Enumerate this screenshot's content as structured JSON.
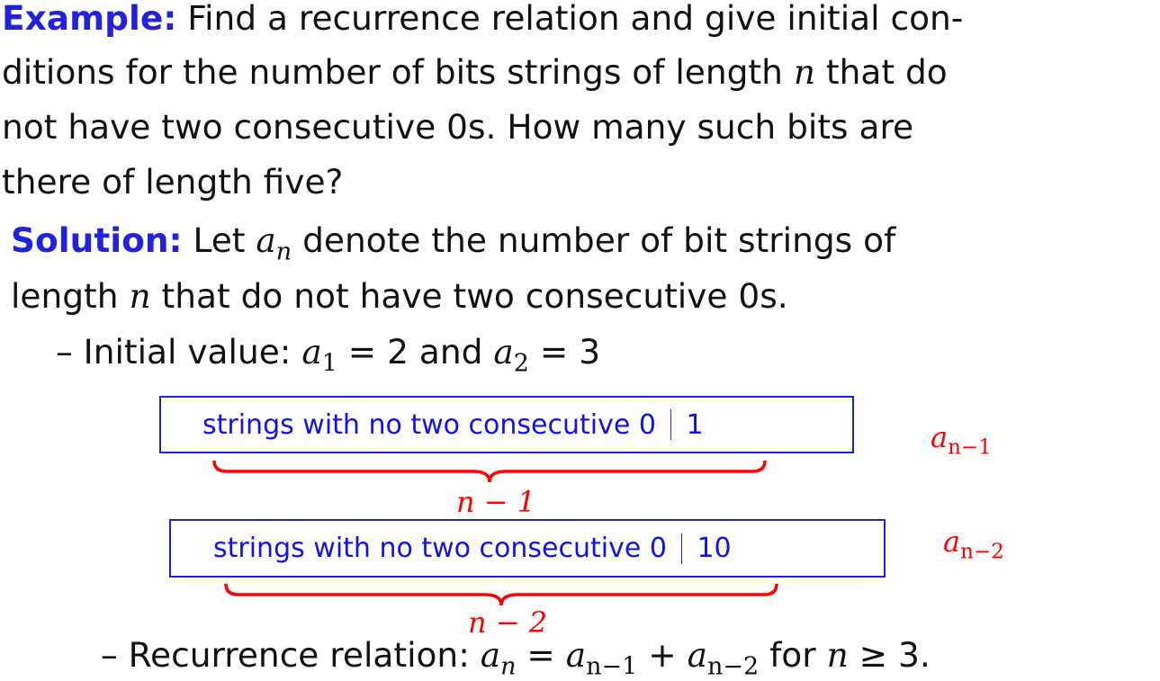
{
  "example": {
    "label": "Example:",
    "t1": " Find a recurrence relation and give initial con-",
    "t2a": "ditions for the number of bits strings of length ",
    "var_n": "n",
    "t2b": " that do",
    "t3": "not have two consecutive 0s.  How many such bits are",
    "t4": "there of length five?"
  },
  "solution": {
    "label": "Solution:",
    "t1a": "  Let ",
    "var_a": "a",
    "sub_n": "n",
    "t1b": " denote the number of bit strings of",
    "t2a": "length ",
    "var_n": "n",
    "t2b": " that do not have two consecutive 0s."
  },
  "initial": {
    "dash": "–",
    "text": " Initial value: ",
    "a": "a",
    "sub1": "1",
    "eq1": " = 2",
    "and": " and ",
    "sub2": "2",
    "eq2": " = 3"
  },
  "diagram": {
    "box1": {
      "text": "strings with no two consecutive 0",
      "suffix": "1"
    },
    "box1_label": {
      "a": "a",
      "sub": "n−1"
    },
    "brace1_label": "n − 1",
    "box2": {
      "text": "strings with no two consecutive 0",
      "suffix": "10"
    },
    "box2_label": {
      "a": "a",
      "sub": "n−2"
    },
    "brace2_label": "n − 2"
  },
  "recurrence": {
    "dash": "–",
    "text": " Recurrence relation: ",
    "a": "a",
    "sub_n": "n",
    "eq": " = ",
    "sub_n1": "n−1",
    "plus": " + ",
    "sub_n2": "n−2",
    "for": " for ",
    "n": "n",
    "geq": " ≥ 3."
  },
  "colors": {
    "heading_blue": "#2222dd",
    "box_blue": "#1111ee",
    "annotation_red": "#ff0000"
  }
}
